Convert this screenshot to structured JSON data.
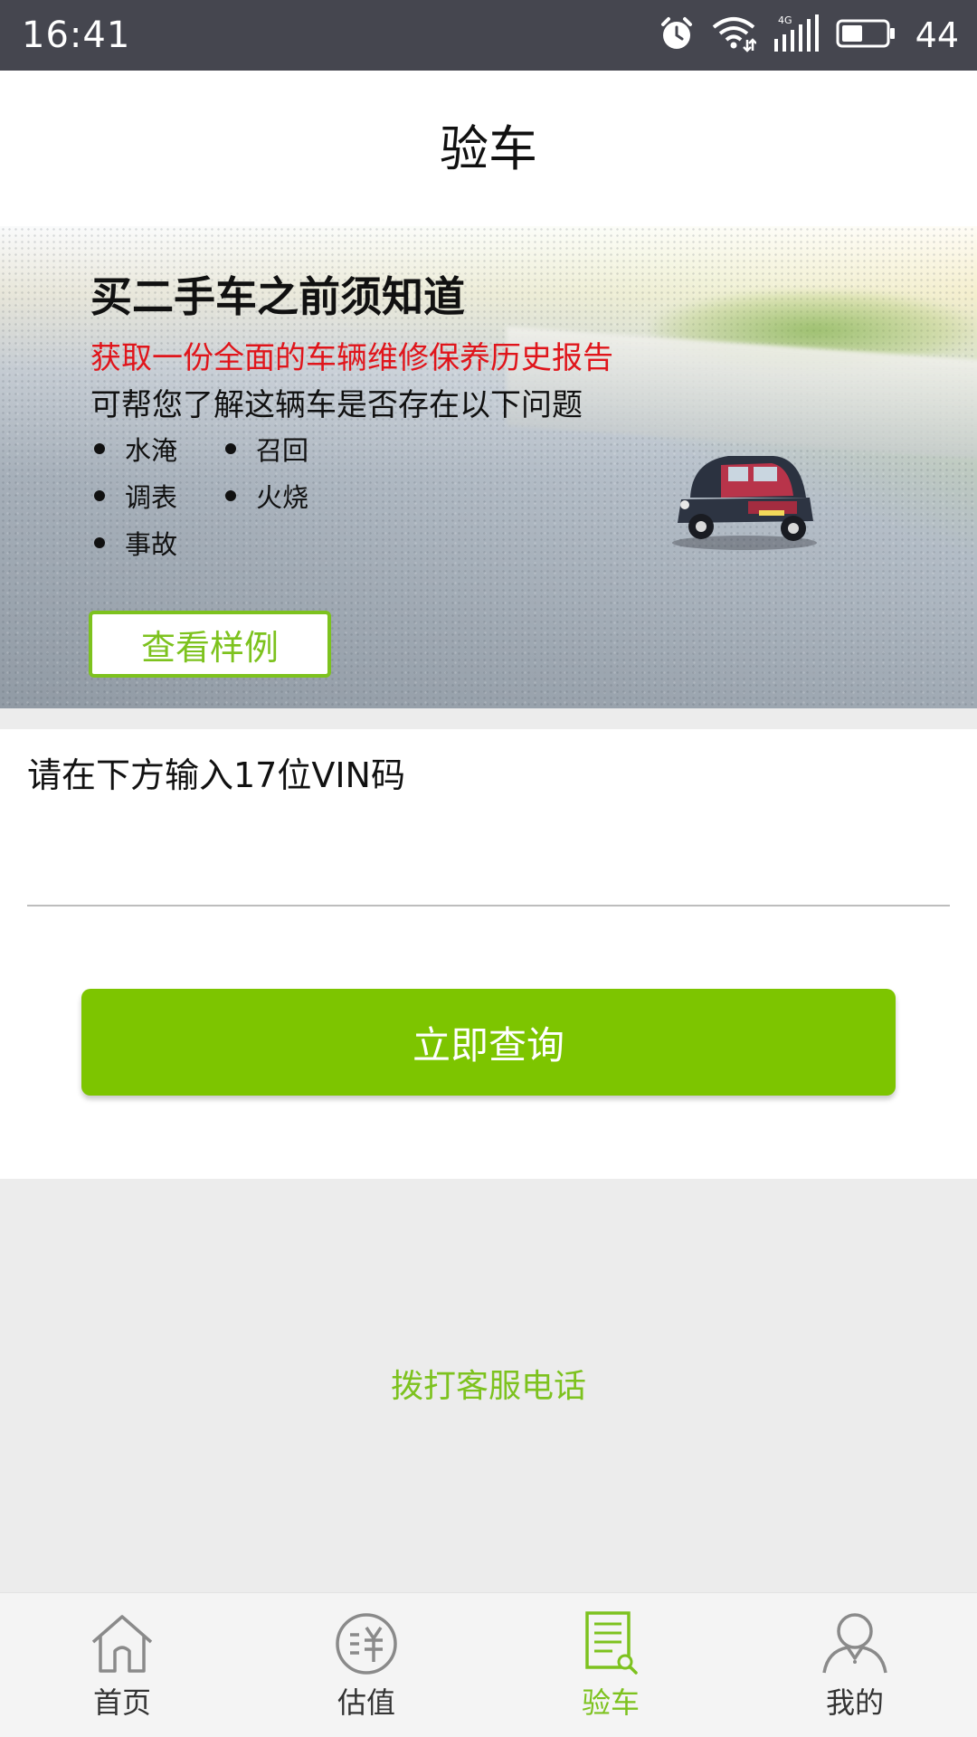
{
  "status_bar": {
    "time": "16:41",
    "network": "4G",
    "battery": "44",
    "icons": [
      "alarm-icon",
      "wifi-icon",
      "signal-icon",
      "battery-icon"
    ]
  },
  "header": {
    "title": "验车"
  },
  "banner": {
    "heading": "买二手车之前须知道",
    "subtitle_red": "获取一份全面的车辆维修保养历史报告",
    "subtitle": "可帮您了解这辆车是否存在以下问题",
    "issues": [
      "水淹",
      "召回",
      "调表",
      "火烧",
      "事故"
    ],
    "sample_button": "查看样例"
  },
  "vin": {
    "label": "请在下方输入17位VIN码",
    "value": "",
    "placeholder": ""
  },
  "query_button": "立即查询",
  "call_service": "拨打客服电话",
  "bottom_nav": {
    "items": [
      {
        "label": "首页",
        "icon": "home-icon",
        "active": false
      },
      {
        "label": "估值",
        "icon": "valuation-icon",
        "active": false
      },
      {
        "label": "验车",
        "icon": "inspection-report-icon",
        "active": true
      },
      {
        "label": "我的",
        "icon": "user-icon",
        "active": false
      }
    ]
  },
  "colors": {
    "accent": "#7dc21e",
    "button": "#7dc500",
    "status_bar": "#45464f",
    "highlight_red": "#e0151b"
  }
}
